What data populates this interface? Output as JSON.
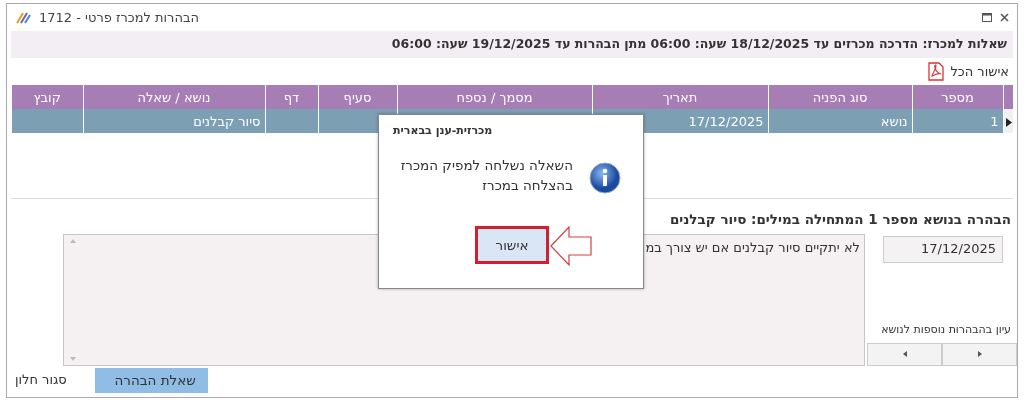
{
  "window": {
    "title": "הבהרות למכרז פרטי - 1712"
  },
  "info_line": "שאלות למכרז: הדרכה מכרזים עד 18/12/2025 שעה: 06:00 מתן הבהרות עד 19/12/2025 שעה: 06:00",
  "toolbar": {
    "approve_all": "אישור הכל"
  },
  "table": {
    "columns": [
      "מספר",
      "סוג הפניה",
      "תאריך",
      "מסמך / נספח",
      "סעיף",
      "דף",
      "נושא / שאלה",
      "קובץ"
    ],
    "rows": [
      {
        "selected": true,
        "number": "1",
        "type": "נושא",
        "date": "17/12/2025",
        "subject": "סיור קבלנים"
      }
    ]
  },
  "detail": {
    "heading": "הבהרה בנושא מספר 1 המתחילה במילים: סיור קבלנים",
    "date": "17/12/2025",
    "answer": "לא יתקיים סיור קבלנים אם יש צורך במ",
    "browse_label": "עיון בהבהרות נוספות לנושא"
  },
  "buttons": {
    "close": "סגור חלון",
    "ask": "שאלת הבהרה"
  },
  "dialog": {
    "title": "מכרזית-ענן בבארית",
    "message_lines": [
      "השאלה נשלחה למפיק המכרז",
      "בהצלחה במכרז"
    ],
    "ok": "אישור"
  }
}
